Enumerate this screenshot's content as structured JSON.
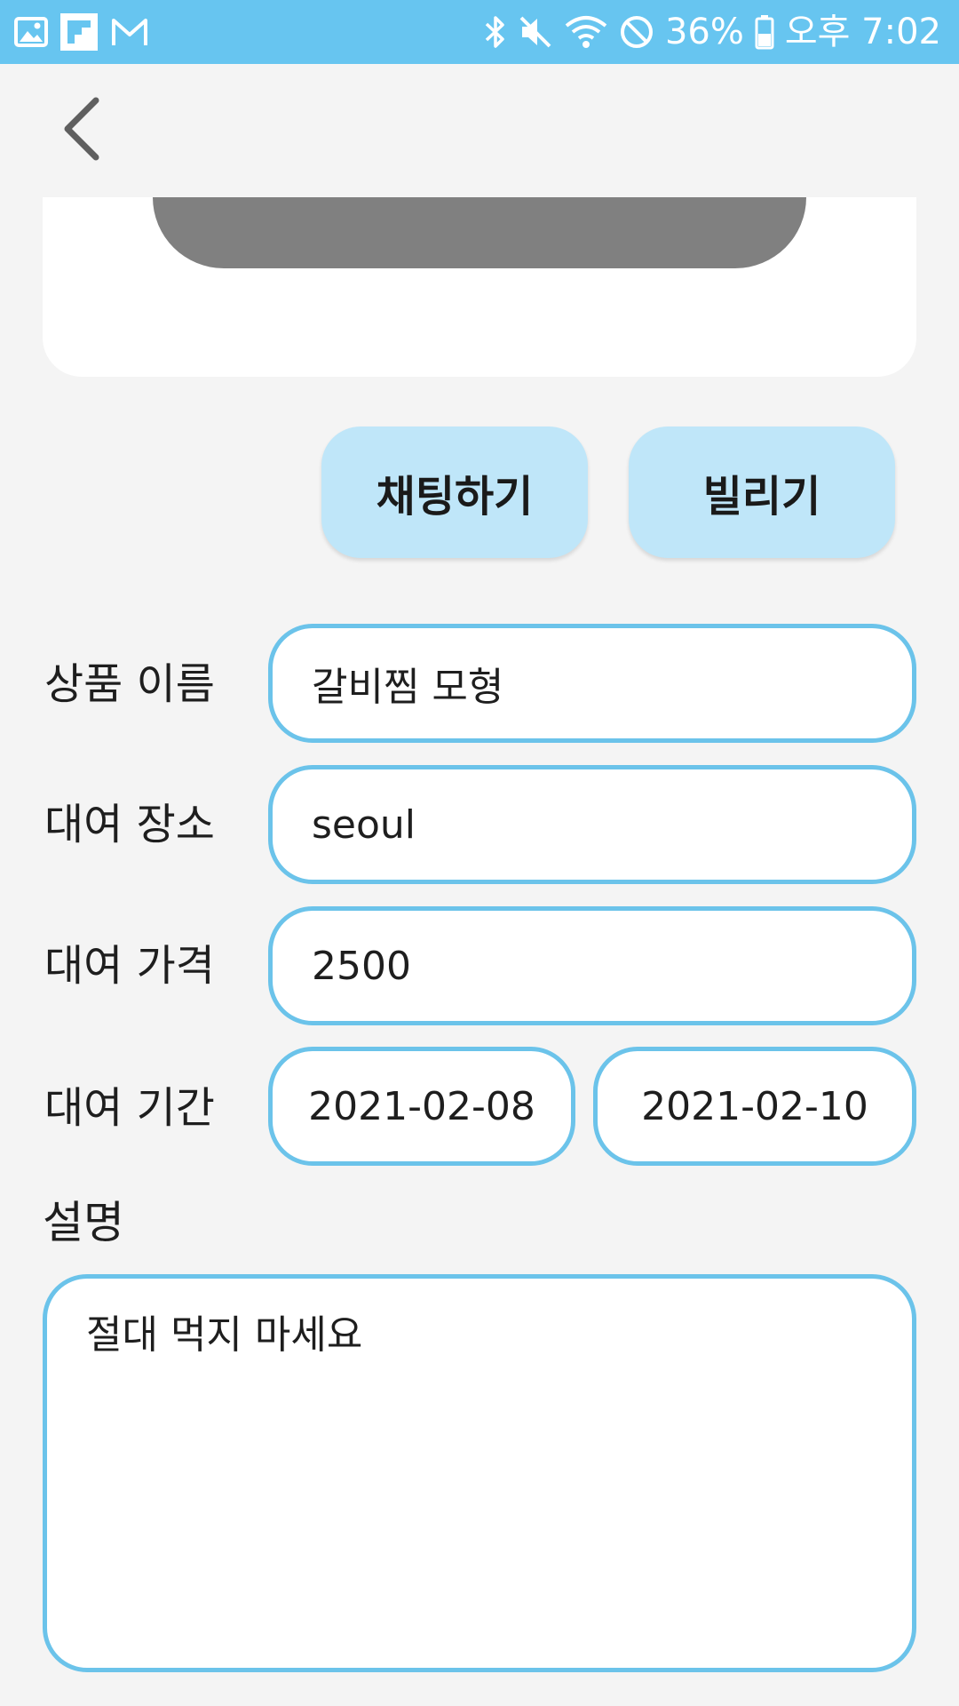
{
  "status_bar": {
    "battery": "36%",
    "time": "오후 7:02",
    "colors": {
      "background": "#67c5f0"
    },
    "left_icons": [
      "gallery-icon",
      "flipboard-icon",
      "gmail-icon"
    ],
    "right_icons": [
      "bluetooth-icon",
      "mute-icon",
      "wifi-icon",
      "do-not-disturb-icon",
      "battery-icon"
    ]
  },
  "nav": {
    "back_icon": "chevron-left-icon"
  },
  "actions": {
    "chat_label": "채팅하기",
    "rent_label": "빌리기"
  },
  "form": {
    "name": {
      "label": "상품 이름",
      "value": "갈비찜 모형"
    },
    "place": {
      "label": "대여 장소",
      "value": "seoul"
    },
    "price": {
      "label": "대여 가격",
      "value": "2500"
    },
    "period": {
      "label": "대여 기간",
      "start": "2021-02-08",
      "end": "2021-02-10"
    }
  },
  "description": {
    "label": "설명",
    "value": "절대 먹지 마세요"
  },
  "colors": {
    "accent": "#6bc3ea",
    "button_bg": "#bfe6f9",
    "page_bg": "#f4f4f4"
  }
}
